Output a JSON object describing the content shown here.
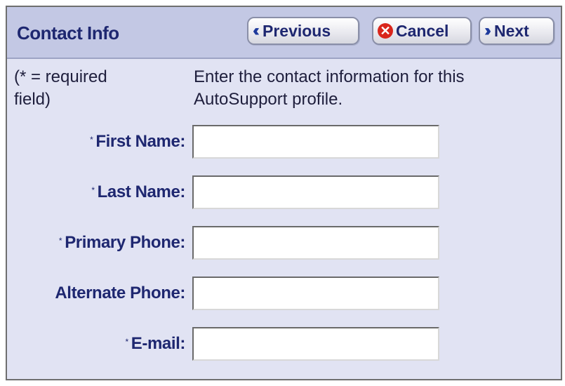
{
  "header": {
    "title": "Contact Info",
    "previous_label": "Previous",
    "cancel_label": "Cancel",
    "next_label": "Next"
  },
  "note": {
    "line1": "(* = required",
    "line2": "field)"
  },
  "instructions": {
    "line1": "Enter the contact information for this",
    "line2": "AutoSupport profile."
  },
  "fields": [
    {
      "label": "First Name:",
      "required": true,
      "value": "",
      "placeholder": ""
    },
    {
      "label": "Last Name:",
      "required": true,
      "value": "",
      "placeholder": ""
    },
    {
      "label": "Primary Phone:",
      "required": true,
      "value": "",
      "placeholder": ""
    },
    {
      "label": "Alternate Phone:",
      "required": false,
      "value": "",
      "placeholder": ""
    },
    {
      "label": "E-mail:",
      "required": true,
      "value": "",
      "placeholder": ""
    }
  ],
  "icons": {
    "previous": "double-chevron-left-icon",
    "cancel": "cancel-circle-x-icon",
    "next": "double-chevron-right-icon"
  },
  "colors": {
    "header_bg": "#c3c8e4",
    "panel_bg": "#e1e3f3",
    "label_text": "#1e2770",
    "cancel_icon": "#d9261c"
  }
}
